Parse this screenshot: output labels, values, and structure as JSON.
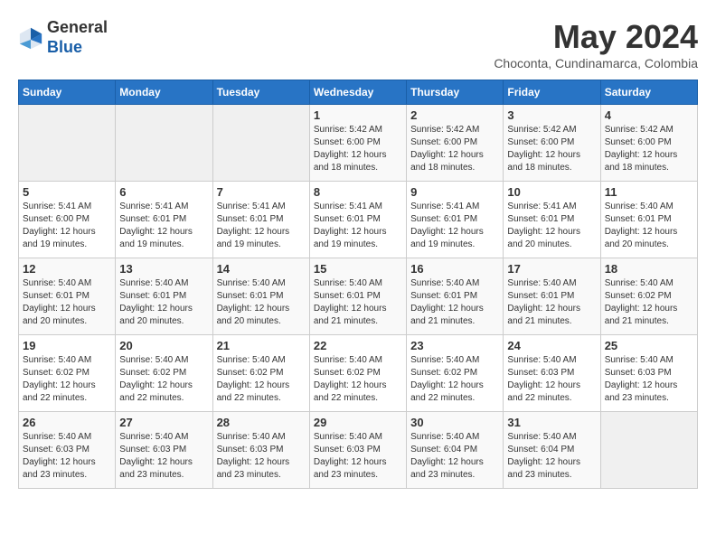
{
  "header": {
    "logo_general": "General",
    "logo_blue": "Blue",
    "month_title": "May 2024",
    "location": "Choconta, Cundinamarca, Colombia"
  },
  "weekdays": [
    "Sunday",
    "Monday",
    "Tuesday",
    "Wednesday",
    "Thursday",
    "Friday",
    "Saturday"
  ],
  "weeks": [
    [
      {
        "day": "",
        "info": ""
      },
      {
        "day": "",
        "info": ""
      },
      {
        "day": "",
        "info": ""
      },
      {
        "day": "1",
        "info": "Sunrise: 5:42 AM\nSunset: 6:00 PM\nDaylight: 12 hours\nand 18 minutes."
      },
      {
        "day": "2",
        "info": "Sunrise: 5:42 AM\nSunset: 6:00 PM\nDaylight: 12 hours\nand 18 minutes."
      },
      {
        "day": "3",
        "info": "Sunrise: 5:42 AM\nSunset: 6:00 PM\nDaylight: 12 hours\nand 18 minutes."
      },
      {
        "day": "4",
        "info": "Sunrise: 5:42 AM\nSunset: 6:00 PM\nDaylight: 12 hours\nand 18 minutes."
      }
    ],
    [
      {
        "day": "5",
        "info": "Sunrise: 5:41 AM\nSunset: 6:00 PM\nDaylight: 12 hours\nand 19 minutes."
      },
      {
        "day": "6",
        "info": "Sunrise: 5:41 AM\nSunset: 6:01 PM\nDaylight: 12 hours\nand 19 minutes."
      },
      {
        "day": "7",
        "info": "Sunrise: 5:41 AM\nSunset: 6:01 PM\nDaylight: 12 hours\nand 19 minutes."
      },
      {
        "day": "8",
        "info": "Sunrise: 5:41 AM\nSunset: 6:01 PM\nDaylight: 12 hours\nand 19 minutes."
      },
      {
        "day": "9",
        "info": "Sunrise: 5:41 AM\nSunset: 6:01 PM\nDaylight: 12 hours\nand 19 minutes."
      },
      {
        "day": "10",
        "info": "Sunrise: 5:41 AM\nSunset: 6:01 PM\nDaylight: 12 hours\nand 20 minutes."
      },
      {
        "day": "11",
        "info": "Sunrise: 5:40 AM\nSunset: 6:01 PM\nDaylight: 12 hours\nand 20 minutes."
      }
    ],
    [
      {
        "day": "12",
        "info": "Sunrise: 5:40 AM\nSunset: 6:01 PM\nDaylight: 12 hours\nand 20 minutes."
      },
      {
        "day": "13",
        "info": "Sunrise: 5:40 AM\nSunset: 6:01 PM\nDaylight: 12 hours\nand 20 minutes."
      },
      {
        "day": "14",
        "info": "Sunrise: 5:40 AM\nSunset: 6:01 PM\nDaylight: 12 hours\nand 20 minutes."
      },
      {
        "day": "15",
        "info": "Sunrise: 5:40 AM\nSunset: 6:01 PM\nDaylight: 12 hours\nand 21 minutes."
      },
      {
        "day": "16",
        "info": "Sunrise: 5:40 AM\nSunset: 6:01 PM\nDaylight: 12 hours\nand 21 minutes."
      },
      {
        "day": "17",
        "info": "Sunrise: 5:40 AM\nSunset: 6:01 PM\nDaylight: 12 hours\nand 21 minutes."
      },
      {
        "day": "18",
        "info": "Sunrise: 5:40 AM\nSunset: 6:02 PM\nDaylight: 12 hours\nand 21 minutes."
      }
    ],
    [
      {
        "day": "19",
        "info": "Sunrise: 5:40 AM\nSunset: 6:02 PM\nDaylight: 12 hours\nand 22 minutes."
      },
      {
        "day": "20",
        "info": "Sunrise: 5:40 AM\nSunset: 6:02 PM\nDaylight: 12 hours\nand 22 minutes."
      },
      {
        "day": "21",
        "info": "Sunrise: 5:40 AM\nSunset: 6:02 PM\nDaylight: 12 hours\nand 22 minutes."
      },
      {
        "day": "22",
        "info": "Sunrise: 5:40 AM\nSunset: 6:02 PM\nDaylight: 12 hours\nand 22 minutes."
      },
      {
        "day": "23",
        "info": "Sunrise: 5:40 AM\nSunset: 6:02 PM\nDaylight: 12 hours\nand 22 minutes."
      },
      {
        "day": "24",
        "info": "Sunrise: 5:40 AM\nSunset: 6:03 PM\nDaylight: 12 hours\nand 22 minutes."
      },
      {
        "day": "25",
        "info": "Sunrise: 5:40 AM\nSunset: 6:03 PM\nDaylight: 12 hours\nand 23 minutes."
      }
    ],
    [
      {
        "day": "26",
        "info": "Sunrise: 5:40 AM\nSunset: 6:03 PM\nDaylight: 12 hours\nand 23 minutes."
      },
      {
        "day": "27",
        "info": "Sunrise: 5:40 AM\nSunset: 6:03 PM\nDaylight: 12 hours\nand 23 minutes."
      },
      {
        "day": "28",
        "info": "Sunrise: 5:40 AM\nSunset: 6:03 PM\nDaylight: 12 hours\nand 23 minutes."
      },
      {
        "day": "29",
        "info": "Sunrise: 5:40 AM\nSunset: 6:03 PM\nDaylight: 12 hours\nand 23 minutes."
      },
      {
        "day": "30",
        "info": "Sunrise: 5:40 AM\nSunset: 6:04 PM\nDaylight: 12 hours\nand 23 minutes."
      },
      {
        "day": "31",
        "info": "Sunrise: 5:40 AM\nSunset: 6:04 PM\nDaylight: 12 hours\nand 23 minutes."
      },
      {
        "day": "",
        "info": ""
      }
    ]
  ]
}
